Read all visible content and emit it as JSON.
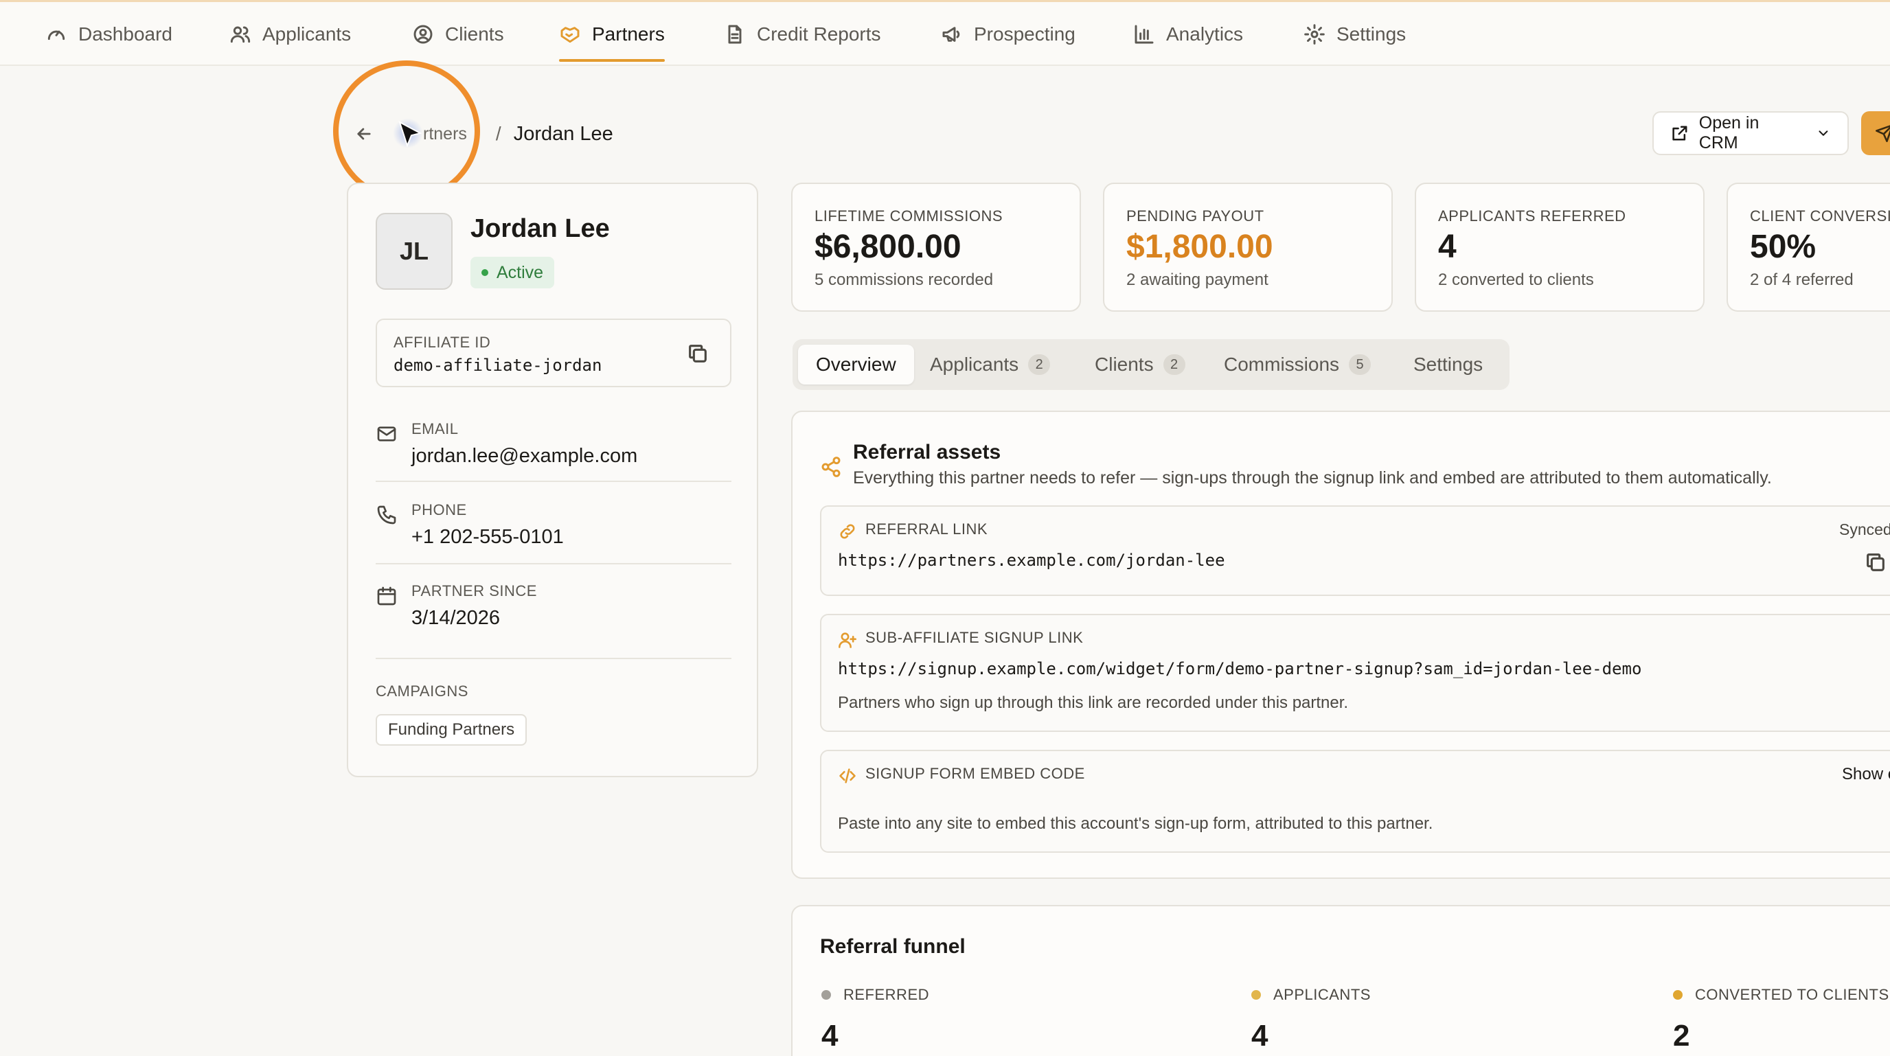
{
  "nav": {
    "items": [
      {
        "label": "Dashboard",
        "icon": "gauge-icon"
      },
      {
        "label": "Applicants",
        "icon": "users-icon"
      },
      {
        "label": "Clients",
        "icon": "user-circle-icon"
      },
      {
        "label": "Partners",
        "icon": "handshake-icon",
        "active": true
      },
      {
        "label": "Credit Reports",
        "icon": "document-icon"
      },
      {
        "label": "Prospecting",
        "icon": "megaphone-icon"
      },
      {
        "label": "Analytics",
        "icon": "bar-chart-icon"
      },
      {
        "label": "Settings",
        "icon": "gear-icon"
      }
    ]
  },
  "breadcrumb": {
    "parent": "Partners",
    "parent_visible": "rtners",
    "separator": "/",
    "current": "Jordan Lee"
  },
  "header_actions": {
    "open_crm": "Open in CRM"
  },
  "profile": {
    "initials": "JL",
    "name": "Jordan Lee",
    "status": "Active",
    "affiliate_label": "AFFILIATE ID",
    "affiliate_id": "demo-affiliate-jordan",
    "email_label": "EMAIL",
    "email": "jordan.lee@example.com",
    "phone_label": "PHONE",
    "phone": "+1 202-555-0101",
    "since_label": "PARTNER SINCE",
    "since": "3/14/2026",
    "campaigns_label": "CAMPAIGNS",
    "campaigns": [
      "Funding Partners"
    ]
  },
  "stats": [
    {
      "label": "LIFETIME COMMISSIONS",
      "value": "$6,800.00",
      "sub": "5 commissions recorded"
    },
    {
      "label": "PENDING PAYOUT",
      "value": "$1,800.00",
      "sub": "2 awaiting payment"
    },
    {
      "label": "APPLICANTS REFERRED",
      "value": "4",
      "sub": "2 converted to clients"
    },
    {
      "label": "CLIENT CONVERSIO",
      "value": "50%",
      "sub": "2 of 4 referred"
    }
  ],
  "tabs": [
    {
      "label": "Overview",
      "active": true
    },
    {
      "label": "Applicants",
      "count": "2"
    },
    {
      "label": "Clients",
      "count": "2"
    },
    {
      "label": "Commissions",
      "count": "5"
    },
    {
      "label": "Settings"
    }
  ],
  "assets": {
    "title": "Referral assets",
    "description": "Everything this partner needs to refer — sign-ups through the signup link and embed are attributed to them automatically.",
    "referral_link": {
      "label": "REFERRAL LINK",
      "value": "https://partners.example.com/jordan-lee",
      "status": "Synced"
    },
    "signup_link": {
      "label": "SUB-AFFILIATE SIGNUP LINK",
      "value": "https://signup.example.com/widget/form/demo-partner-signup?sam_id=jordan-lee-demo",
      "note": "Partners who sign up through this link are recorded under this partner."
    },
    "embed": {
      "label": "SIGNUP FORM EMBED CODE",
      "action": "Show code",
      "note": "Paste into any site to embed this account's sign-up form, attributed to this partner."
    }
  },
  "funnel": {
    "title": "Referral funnel",
    "stages": [
      {
        "label": "REFERRED",
        "value": "4",
        "color": "#a3a09a"
      },
      {
        "label": "APPLICANTS",
        "value": "4",
        "color": "#e2b64c"
      },
      {
        "label": "CONVERTED TO CLIENTS",
        "value": "2",
        "color": "#e0a630"
      }
    ]
  },
  "colors": {
    "accent": "#e39b2e",
    "pending": "#d9831f",
    "active_status": "#2f7d3c"
  }
}
